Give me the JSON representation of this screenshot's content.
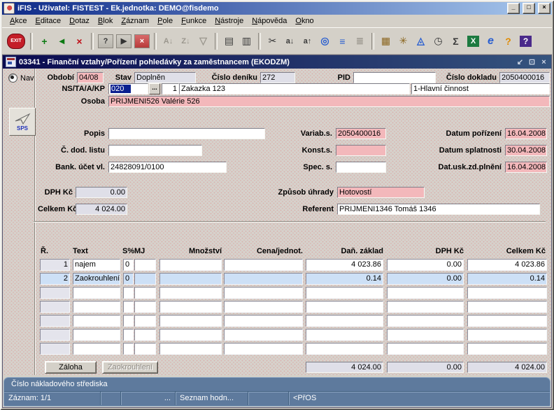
{
  "window": {
    "title": "iFIS - Uživatel: FISTEST - Ek.jednotka: DEMO@fisdemo"
  },
  "menu": {
    "items": [
      "Akce",
      "Editace",
      "Dotaz",
      "Blok",
      "Záznam",
      "Pole",
      "Funkce",
      "Nástroje",
      "Nápověda",
      "Okno"
    ]
  },
  "toolbar": {
    "icons": [
      {
        "name": "exit",
        "glyph": "EXIT"
      },
      {
        "name": "record-add",
        "glyph": "+"
      },
      {
        "name": "record-duplicate",
        "glyph": "◂"
      },
      {
        "name": "record-delete",
        "glyph": "×"
      },
      {
        "name": "query-enter",
        "glyph": "?"
      },
      {
        "name": "query-execute",
        "glyph": "▶"
      },
      {
        "name": "query-cancel",
        "glyph": "×"
      },
      {
        "name": "sort-asc",
        "glyph": "A↓"
      },
      {
        "name": "sort-desc",
        "glyph": "Z↓"
      },
      {
        "name": "filter",
        "glyph": "▽"
      },
      {
        "name": "print",
        "glyph": "▤"
      },
      {
        "name": "print-batch",
        "glyph": "▥"
      },
      {
        "name": "cut",
        "glyph": "✂"
      },
      {
        "name": "copy-field-down",
        "glyph": "a↓"
      },
      {
        "name": "copy-field-up",
        "glyph": "a↑"
      },
      {
        "name": "zoom-detail",
        "glyph": "◎"
      },
      {
        "name": "list-of-values",
        "glyph": "≡"
      },
      {
        "name": "tree-view",
        "glyph": "≣"
      },
      {
        "name": "form-detail",
        "glyph": "▦"
      },
      {
        "name": "navigator",
        "glyph": "✳"
      },
      {
        "name": "monitor",
        "glyph": "◬"
      },
      {
        "name": "calculator",
        "glyph": "◷"
      },
      {
        "name": "sum",
        "glyph": "Σ"
      },
      {
        "name": "excel-export",
        "glyph": "X"
      },
      {
        "name": "browser",
        "glyph": "e"
      },
      {
        "name": "wizard-help",
        "glyph": "?"
      },
      {
        "name": "help",
        "glyph": "?"
      }
    ]
  },
  "mdi": {
    "title": "03341 - Finanční vztahy/Pořízení pohledávky za zaměstnancem (EKODZM)",
    "controls": {
      "minimize": "↙",
      "restore": "⊡",
      "close": "×"
    }
  },
  "sidebar": {
    "nav": "Nav",
    "sps": "SPS"
  },
  "fields": {
    "obdobi": {
      "label": "Období",
      "value": "04/08"
    },
    "stav": {
      "label": "Stav",
      "value": "Doplněn"
    },
    "cislo_deniku": {
      "label": "Číslo deníku",
      "value": "272"
    },
    "pid": {
      "label": "PID",
      "value": ""
    },
    "cislo_dokladu": {
      "label": "Číslo dokladu",
      "value": "2050400016"
    },
    "ns_ta_a_kp": {
      "label": "NS/TA/A/KP",
      "code": "020",
      "browse": "...",
      "ta": "1",
      "name": "Zakazka 123",
      "cinnost": "1-Hlavní činnost"
    },
    "osoba": {
      "label": "Osoba",
      "value": "PRIJMENI526 Valérie 526"
    },
    "popis": {
      "label": "Popis",
      "value": ""
    },
    "c_dod_listu": {
      "label": "Č. dod. listu",
      "value": ""
    },
    "bank_ucet": {
      "label": "Bank. účet vl.",
      "value": "24828091/0100"
    },
    "variab_s": {
      "label": "Variab.s.",
      "value": "2050400016"
    },
    "konst_s": {
      "label": "Konst.s.",
      "value": ""
    },
    "spec_s": {
      "label": "Spec. s.",
      "value": ""
    },
    "datum_porizeni": {
      "label": "Datum pořízení",
      "value": "16.04.2008"
    },
    "datum_splatnosti": {
      "label": "Datum splatnosti",
      "value": "30.04.2008"
    },
    "dat_usk_zd_plneni": {
      "label": "Dat.usk.zd.plnění",
      "value": "16.04.2008"
    },
    "dph_kc": {
      "label": "DPH Kč",
      "value": "0.00"
    },
    "celkem_kc": {
      "label": "Celkem Kč",
      "value": "4 024.00"
    },
    "zpusob_uhrady": {
      "label": "Způsob úhrady",
      "value": "Hotovostí"
    },
    "referent": {
      "label": "Referent",
      "value": "PRIJMENI1346 Tomáš 1346"
    }
  },
  "items_table": {
    "columns": [
      "Ř.",
      "Text",
      "S%",
      "MJ",
      "Množství",
      "Cena/jednot.",
      "Daň. základ",
      "DPH Kč",
      "Celkem Kč"
    ],
    "rows": [
      {
        "r": "1",
        "text": "najem",
        "s": "0",
        "mj": "",
        "mnozstvi": "",
        "cena": "",
        "dan": "4 023.86",
        "dph": "0.00",
        "celkem": "4 023.86"
      },
      {
        "r": "2",
        "text": "Zaokrouhlení",
        "s": "0",
        "mj": "",
        "mnozstvi": "",
        "cena": "",
        "dan": "0.14",
        "dph": "0.00",
        "celkem": "0.14"
      },
      {
        "r": "",
        "text": "",
        "s": "",
        "mj": "",
        "mnozstvi": "",
        "cena": "",
        "dan": "",
        "dph": "",
        "celkem": ""
      },
      {
        "r": "",
        "text": "",
        "s": "",
        "mj": "",
        "mnozstvi": "",
        "cena": "",
        "dan": "",
        "dph": "",
        "celkem": ""
      },
      {
        "r": "",
        "text": "",
        "s": "",
        "mj": "",
        "mnozstvi": "",
        "cena": "",
        "dan": "",
        "dph": "",
        "celkem": ""
      },
      {
        "r": "",
        "text": "",
        "s": "",
        "mj": "",
        "mnozstvi": "",
        "cena": "",
        "dan": "",
        "dph": "",
        "celkem": ""
      },
      {
        "r": "",
        "text": "",
        "s": "",
        "mj": "",
        "mnozstvi": "",
        "cena": "",
        "dan": "",
        "dph": "",
        "celkem": ""
      }
    ],
    "totals": {
      "dan": "4 024.00",
      "dph": "0.00",
      "celkem": "4 024.00"
    }
  },
  "buttons": {
    "zaloha": "Záloha",
    "zaokrouhleni": "Zaokrouhlení"
  },
  "statusbar": {
    "hint": "Číslo nákladového střediska",
    "record": "Záznam: 1/1",
    "dots": "...",
    "list_values": "Seznam hodn...",
    "pros": "<PřOS"
  },
  "window_controls": {
    "minimize": "_",
    "maximize": "□",
    "close": "×"
  }
}
